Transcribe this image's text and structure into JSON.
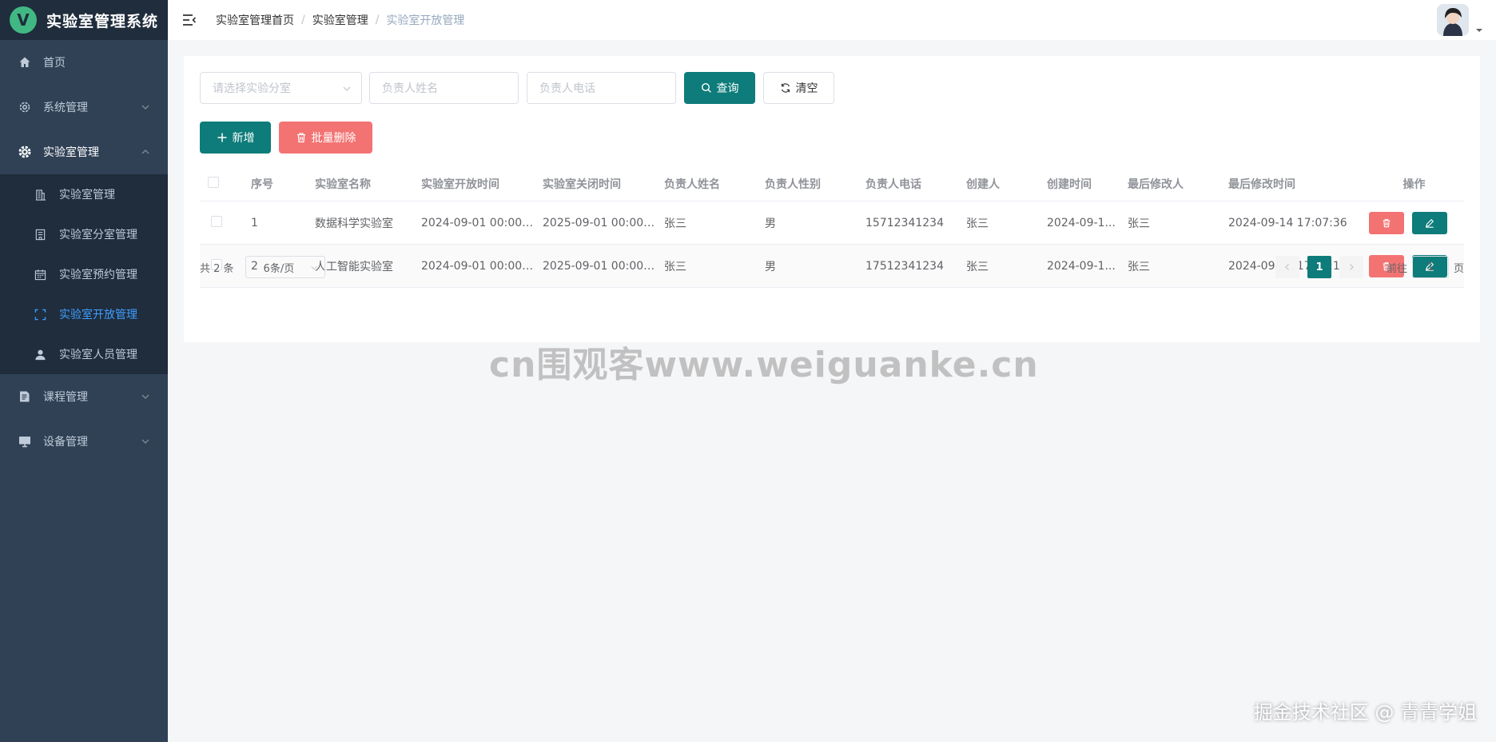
{
  "app": {
    "title": "实验室管理系统",
    "logo_letter": "V"
  },
  "sidebar": {
    "items": [
      {
        "label": "首页",
        "icon": "home-icon"
      },
      {
        "label": "系统管理",
        "icon": "gear-outline-icon"
      },
      {
        "label": "实验室管理",
        "icon": "gear-filled-icon"
      },
      {
        "label": "课程管理",
        "icon": "document-icon"
      },
      {
        "label": "设备管理",
        "icon": "monitor-icon"
      }
    ],
    "sub_items": [
      {
        "label": "实验室管理",
        "icon": "building-icon"
      },
      {
        "label": "实验室分室管理",
        "icon": "office-icon"
      },
      {
        "label": "实验室预约管理",
        "icon": "calendar-icon"
      },
      {
        "label": "实验室开放管理",
        "icon": "scan-frame-icon"
      },
      {
        "label": "实验室人员管理",
        "icon": "user-icon"
      }
    ]
  },
  "header": {
    "breadcrumb": [
      "实验室管理首页",
      "实验室管理",
      "实验室开放管理"
    ]
  },
  "filters": {
    "room_placeholder": "请选择实验分室",
    "name_placeholder": "负责人姓名",
    "phone_placeholder": "负责人电话",
    "search_label": "查询",
    "clear_label": "清空"
  },
  "actions": {
    "add_label": "新增",
    "batch_delete_label": "批量删除"
  },
  "table": {
    "columns": [
      "序号",
      "实验室名称",
      "实验室开放时间",
      "实验室关闭时间",
      "负责人姓名",
      "负责人性别",
      "负责人电话",
      "创建人",
      "创建时间",
      "最后修改人",
      "最后修改时间",
      "操作"
    ],
    "rows": [
      [
        "1",
        "数据科学实验室",
        "2024-09-01 00:00:00",
        "2025-09-01 00:00:00",
        "张三",
        "男",
        "15712341234",
        "张三",
        "2024-09-1...",
        "张三",
        "2024-09-14 17:07:36"
      ],
      [
        "2",
        "人工智能实验室",
        "2024-09-01 00:00:00",
        "2025-09-01 00:00:00",
        "张三",
        "男",
        "17512341234",
        "张三",
        "2024-09-1...",
        "张三",
        "2024-09-14 17:07:11"
      ]
    ]
  },
  "pagination": {
    "total": "共 2 条",
    "page_size": "6条/页",
    "current_page": "1",
    "goto_label": "前往",
    "goto_value": "1",
    "page_suffix": "页"
  },
  "watermarks": {
    "center": "cn围观客www.weiguanke.cn",
    "corner": "掘金技术社区 @ 青青学姐"
  },
  "colors": {
    "sidebar_bg": "#304156",
    "submenu_bg": "#1f2d3d",
    "primary": "#0d7c7a",
    "danger": "#f37373",
    "active_link": "#409eff"
  }
}
